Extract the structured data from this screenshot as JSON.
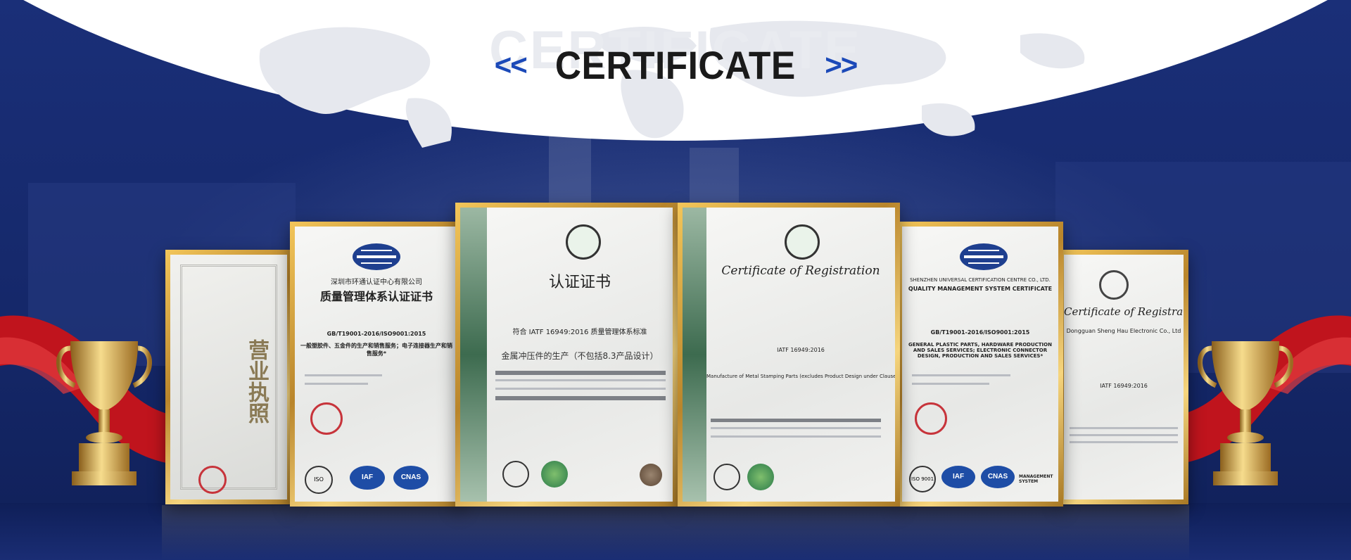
{
  "header": {
    "ghost": "CERTIFICATE",
    "title": "CERTIFICATE",
    "left_arrows": "<<",
    "right_arrows": ">>"
  },
  "colors": {
    "navy": "#16286b",
    "accent_blue": "#1b49b8",
    "gold": "#d4a33c",
    "ribbon_red": "#c0141d"
  },
  "certificates": [
    {
      "id": "business-license",
      "title": "营业执照",
      "seal": "red-seal"
    },
    {
      "id": "qms-cn",
      "org": "深圳市环通认证中心有限公司",
      "title": "质量管理体系认证证书",
      "standard": "GB/T19001-2016/ISO9001:2015",
      "scope": "一般塑胶件、五金件的生产和销售服务；电子连接器生产和销售服务*",
      "logos": [
        "ISO 9001",
        "IAF",
        "CNAS"
      ]
    },
    {
      "id": "iatf-cn",
      "title": "认证证书",
      "standard": "符合 IATF 16949:2016 质量管理体系标准",
      "scope": "金属冲压件的生产（不包括8.3产品设计）"
    },
    {
      "id": "iatf-en",
      "title": "Certificate of Registration",
      "standard": "IATF 16949:2016",
      "scope": "Manufacture of Metal Stamping Parts (excludes Product Design under Clause 8.3)"
    },
    {
      "id": "qms-en",
      "org": "SHENZHEN UNIVERSAL CERTIFICATION CENTRE CO., LTD.",
      "title": "QUALITY MANAGEMENT SYSTEM CERTIFICATE",
      "standard": "GB/T19001-2016/ISO9001:2015",
      "scope": "GENERAL PLASTIC PARTS, HARDWARE PRODUCTION AND SALES SERVICES; ELECTRONIC CONNECTOR DESIGN, PRODUCTION AND SALES SERVICES*",
      "logos": [
        "ISO 9001",
        "IAF",
        "CNAS"
      ],
      "logo_caption": "MANAGEMENT SYSTEM"
    },
    {
      "id": "iatf-en-2",
      "title": "Certificate of Registration",
      "company": "Dongguan Sheng Hau Electronic Co., Ltd",
      "standard": "IATF 16949:2016"
    }
  ],
  "trophies": {
    "left": "trophy-icon",
    "right": "trophy-icon"
  }
}
